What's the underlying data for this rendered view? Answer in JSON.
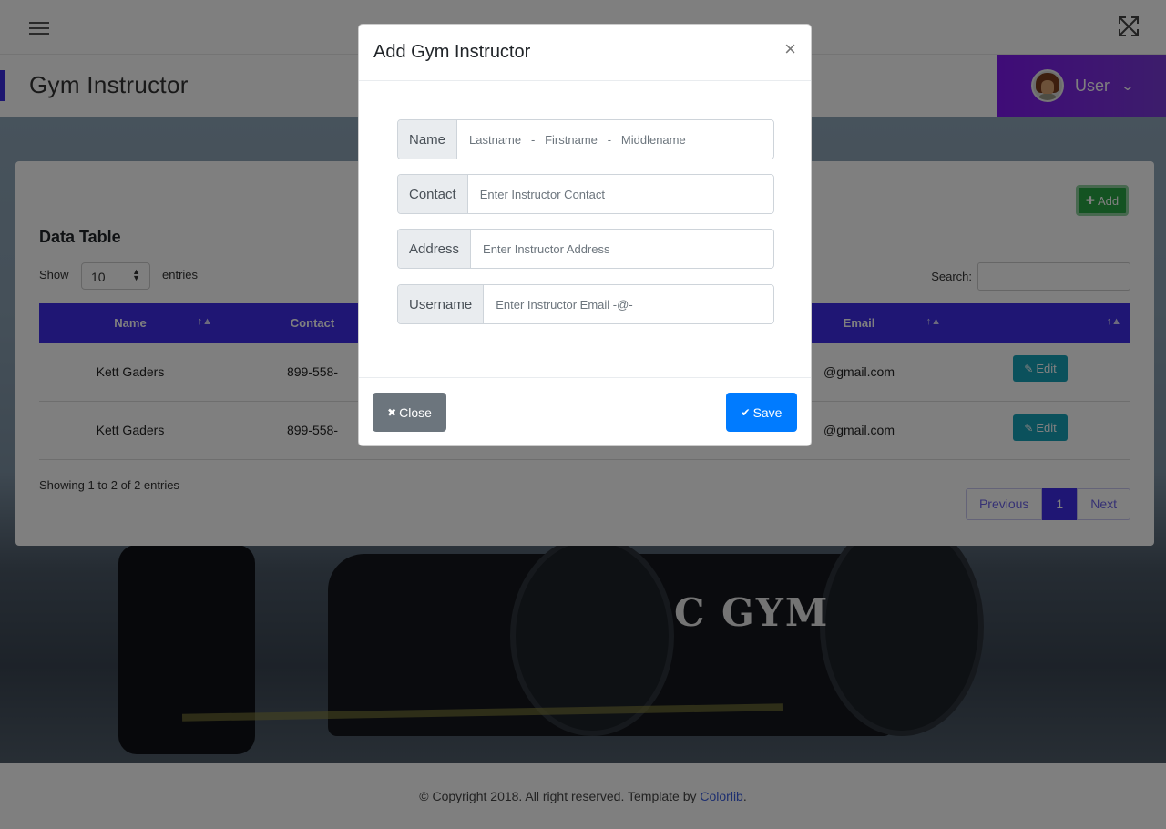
{
  "topbar": {
    "menu_icon": "hamburger-icon",
    "fullscreen_icon": "expand-icon"
  },
  "header": {
    "page_title": "Gym Instructor",
    "user_label": "User",
    "user_chevron": "⌄",
    "accent_color": "#7f18f0"
  },
  "card": {
    "add_button": "Add",
    "add_icon": "✚",
    "title": "Data Table",
    "show_label": "Show",
    "show_value": "10",
    "entries_label": "entries",
    "search_label": "Search:",
    "search_value": "",
    "columns": [
      "Name",
      "Contact",
      "",
      "",
      "Email",
      ""
    ],
    "rows": [
      {
        "name": "Kett Gaders",
        "contact": "899-558-",
        "email": "@gmail.com",
        "action": "Edit"
      },
      {
        "name": "Kett Gaders",
        "contact": "899-558-",
        "email": "@gmail.com",
        "action": "Edit"
      }
    ],
    "showing_text": "Showing 1 to 2 of 2 entries",
    "pagination": {
      "previous": "Previous",
      "current": "1",
      "next": "Next"
    },
    "header_color": "#3f2de8"
  },
  "background": {
    "logo_text": "C GYM"
  },
  "footer": {
    "text": "© Copyright 2018. All right reserved. Template by ",
    "link": "Colorlib",
    "suffix": "."
  },
  "modal": {
    "title": "Add Gym Instructor",
    "close_glyph": "×",
    "fields": [
      {
        "label": "Name",
        "placeholder": "Lastname   -   Firstname   -   Middlename",
        "value": ""
      },
      {
        "label": "Contact",
        "placeholder": "Enter Instructor Contact",
        "value": ""
      },
      {
        "label": "Address",
        "placeholder": "Enter Instructor Address",
        "value": ""
      },
      {
        "label": "Username",
        "placeholder": "Enter Instructor Email -@-",
        "value": ""
      }
    ],
    "close_button": "Close",
    "close_icon": "✖",
    "save_button": "Save",
    "save_icon": "✔",
    "save_color": "#007bff"
  }
}
